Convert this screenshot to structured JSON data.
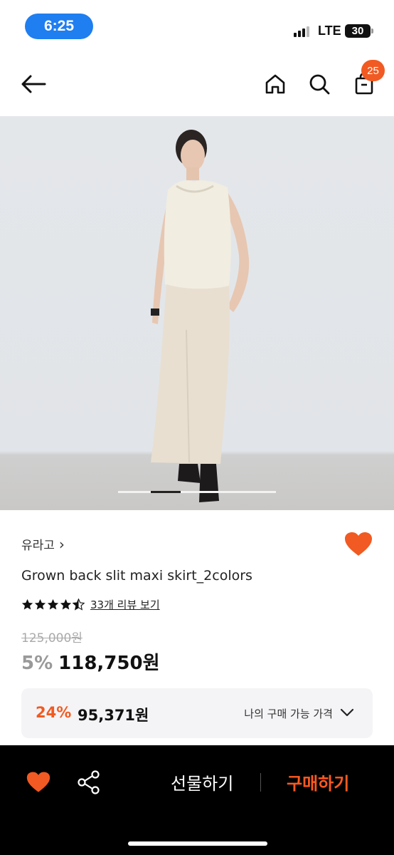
{
  "status_bar": {
    "time": "6:25",
    "network": "LTE",
    "battery": "30"
  },
  "nav": {
    "cart_count": "25"
  },
  "product": {
    "brand": "유라고",
    "brand_chevron": "›",
    "title": "Grown back slit maxi skirt_2colors",
    "rating": 4.5,
    "review_link": "33개 리뷰 보기",
    "original_price": "125,000원",
    "discount": "5%",
    "price": "118,750원"
  },
  "my_price": {
    "discount": "24%",
    "price": "95,371원",
    "label": "나의 구매 가능 가격"
  },
  "bottom_bar": {
    "gift_label": "선물하기",
    "buy_label": "구매하기"
  },
  "colors": {
    "accent": "#f15a22",
    "status_pill": "#1f7ef0"
  },
  "icons": [
    "back-arrow-icon",
    "home-icon",
    "search-icon",
    "shopping-bag-icon",
    "heart-icon",
    "share-icon",
    "chevron-down-icon",
    "star-icon"
  ]
}
